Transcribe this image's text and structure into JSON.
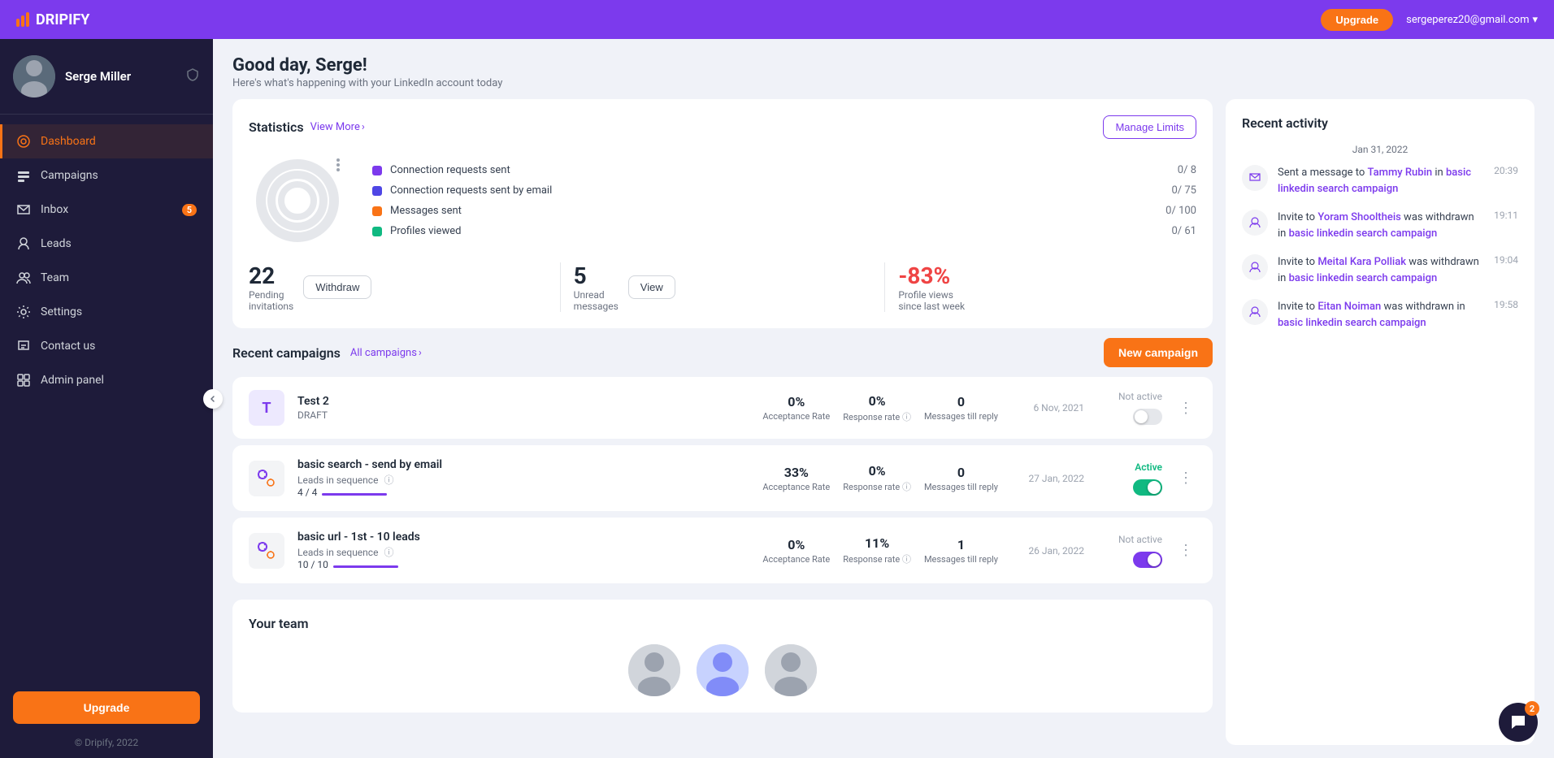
{
  "app": {
    "name": "DRIPIFY",
    "copyright": "© Dripify, 2022"
  },
  "topnav": {
    "upgrade_label": "Upgrade",
    "user_email": "sergeperez20@gmail.com",
    "chevron": "▾"
  },
  "sidebar": {
    "user": {
      "name": "Serge Miller"
    },
    "nav_items": [
      {
        "id": "dashboard",
        "label": "Dashboard",
        "active": true,
        "badge": null
      },
      {
        "id": "campaigns",
        "label": "Campaigns",
        "active": false,
        "badge": null
      },
      {
        "id": "inbox",
        "label": "Inbox",
        "active": false,
        "badge": "5"
      },
      {
        "id": "leads",
        "label": "Leads",
        "active": false,
        "badge": null
      },
      {
        "id": "team",
        "label": "Team",
        "active": false,
        "badge": null
      },
      {
        "id": "settings",
        "label": "Settings",
        "active": false,
        "badge": null
      },
      {
        "id": "contact-us",
        "label": "Contact us",
        "active": false,
        "badge": null
      },
      {
        "id": "admin-panel",
        "label": "Admin panel",
        "active": false,
        "badge": null
      }
    ],
    "upgrade_label": "Upgrade"
  },
  "page": {
    "greeting": "Good day, Serge!",
    "subtitle": "Here's what's happening with your LinkedIn account today"
  },
  "statistics": {
    "title": "Statistics",
    "view_more": "View More",
    "manage_limits": "Manage Limits",
    "items": [
      {
        "label": "Connection requests sent",
        "value": "0/ 8",
        "color": "#7c3aed"
      },
      {
        "label": "Connection requests sent by email",
        "value": "0/ 75",
        "color": "#4f46e5"
      },
      {
        "label": "Messages sent",
        "value": "0/ 100",
        "color": "#f97316"
      },
      {
        "label": "Profiles viewed",
        "value": "0/ 61",
        "color": "#10b981"
      }
    ],
    "counters": [
      {
        "number": "22",
        "label": "Pending\ninvitations",
        "action": "Withdraw"
      },
      {
        "number": "5",
        "label": "Unread\nmessages",
        "action": "View"
      },
      {
        "number": "-83%",
        "label": "Profile views\nsince last week",
        "action": null,
        "negative": true
      }
    ]
  },
  "campaigns": {
    "title": "Recent campaigns",
    "all_campaigns": "All campaigns",
    "new_campaign": "New campaign",
    "items": [
      {
        "id": "test2",
        "icon_letter": "T",
        "icon_type": "letter",
        "name": "Test 2",
        "status": "DRAFT",
        "leads_label": null,
        "leads_progress": null,
        "acceptance_rate": "0%",
        "response_rate": "0%",
        "messages_till_reply": "0",
        "date": "6 Nov, 2021",
        "active_status": "Not active",
        "toggle_on": false,
        "toggle_color": "gray"
      },
      {
        "id": "basic-search-email",
        "icon_letter": null,
        "icon_type": "gear",
        "name": "basic search - send by email",
        "status": "Leads in sequence",
        "leads_label": "4 / 4",
        "leads_progress": 100,
        "acceptance_rate": "33%",
        "response_rate": "0%",
        "messages_till_reply": "0",
        "date": "27 Jan, 2022",
        "active_status": "Active",
        "toggle_on": true,
        "toggle_color": "green"
      },
      {
        "id": "basic-url",
        "icon_letter": null,
        "icon_type": "gear",
        "name": "basic url - 1st - 10 leads",
        "status": "Leads in sequence",
        "leads_label": "10 / 10",
        "leads_progress": 100,
        "acceptance_rate": "0%",
        "response_rate": "11%",
        "messages_till_reply": "1",
        "date": "26 Jan, 2022",
        "active_status": "Not active",
        "toggle_on": true,
        "toggle_color": "purple"
      }
    ]
  },
  "your_team": {
    "title": "Your team"
  },
  "recent_activity": {
    "title": "Recent activity",
    "date_divider": "Jan 31, 2022",
    "items": [
      {
        "text_pre": "Sent a message to ",
        "link": "Tammy Rubin",
        "text_post": " in ",
        "campaign_link": "basic linkedin search campaign",
        "time": "20:39"
      },
      {
        "text_pre": "Invite to ",
        "link": "Yoram Shooltheis",
        "text_post": " was withdrawn in ",
        "campaign_link": "basic linkedin search campaign",
        "time": "19:11"
      },
      {
        "text_pre": "Invite to ",
        "link": "Meital Kara Polliak",
        "text_post": " was withdrawn in ",
        "campaign_link": "basic linkedin search campaign",
        "time": "19:04"
      },
      {
        "text_pre": "Invite to ",
        "link": "Eitan Noiman",
        "text_post": " was withdrawn in ",
        "campaign_link": "basic linkedin search campaign",
        "time": "19:58"
      }
    ]
  },
  "chat": {
    "badge": "2"
  }
}
